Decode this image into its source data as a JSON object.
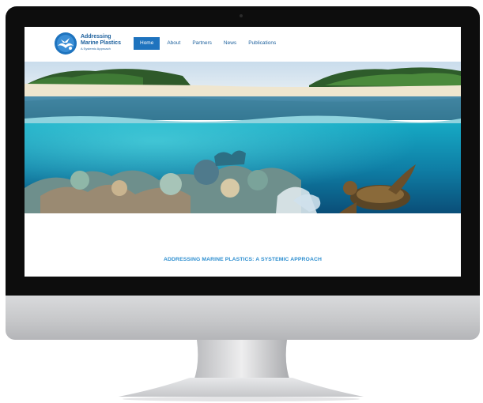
{
  "site": {
    "brand_line1": "Addressing",
    "brand_line2": "Marine Plastics",
    "brand_line3": "A Systemic Approach"
  },
  "nav": {
    "items": [
      {
        "label": "Home",
        "active": true
      },
      {
        "label": "About",
        "active": false
      },
      {
        "label": "Partners",
        "active": false
      },
      {
        "label": "News",
        "active": false
      },
      {
        "label": "Publications",
        "active": false
      }
    ]
  },
  "main": {
    "tagline": "ADDRESSING MARINE PLASTICS: A SYSTEMIC APPROACH"
  },
  "colors": {
    "accent": "#1e73be",
    "brand_text": "#1b5f9c",
    "tagline": "#2f8fd0"
  },
  "icons": {
    "logo": "globe-bird-logo-icon"
  }
}
